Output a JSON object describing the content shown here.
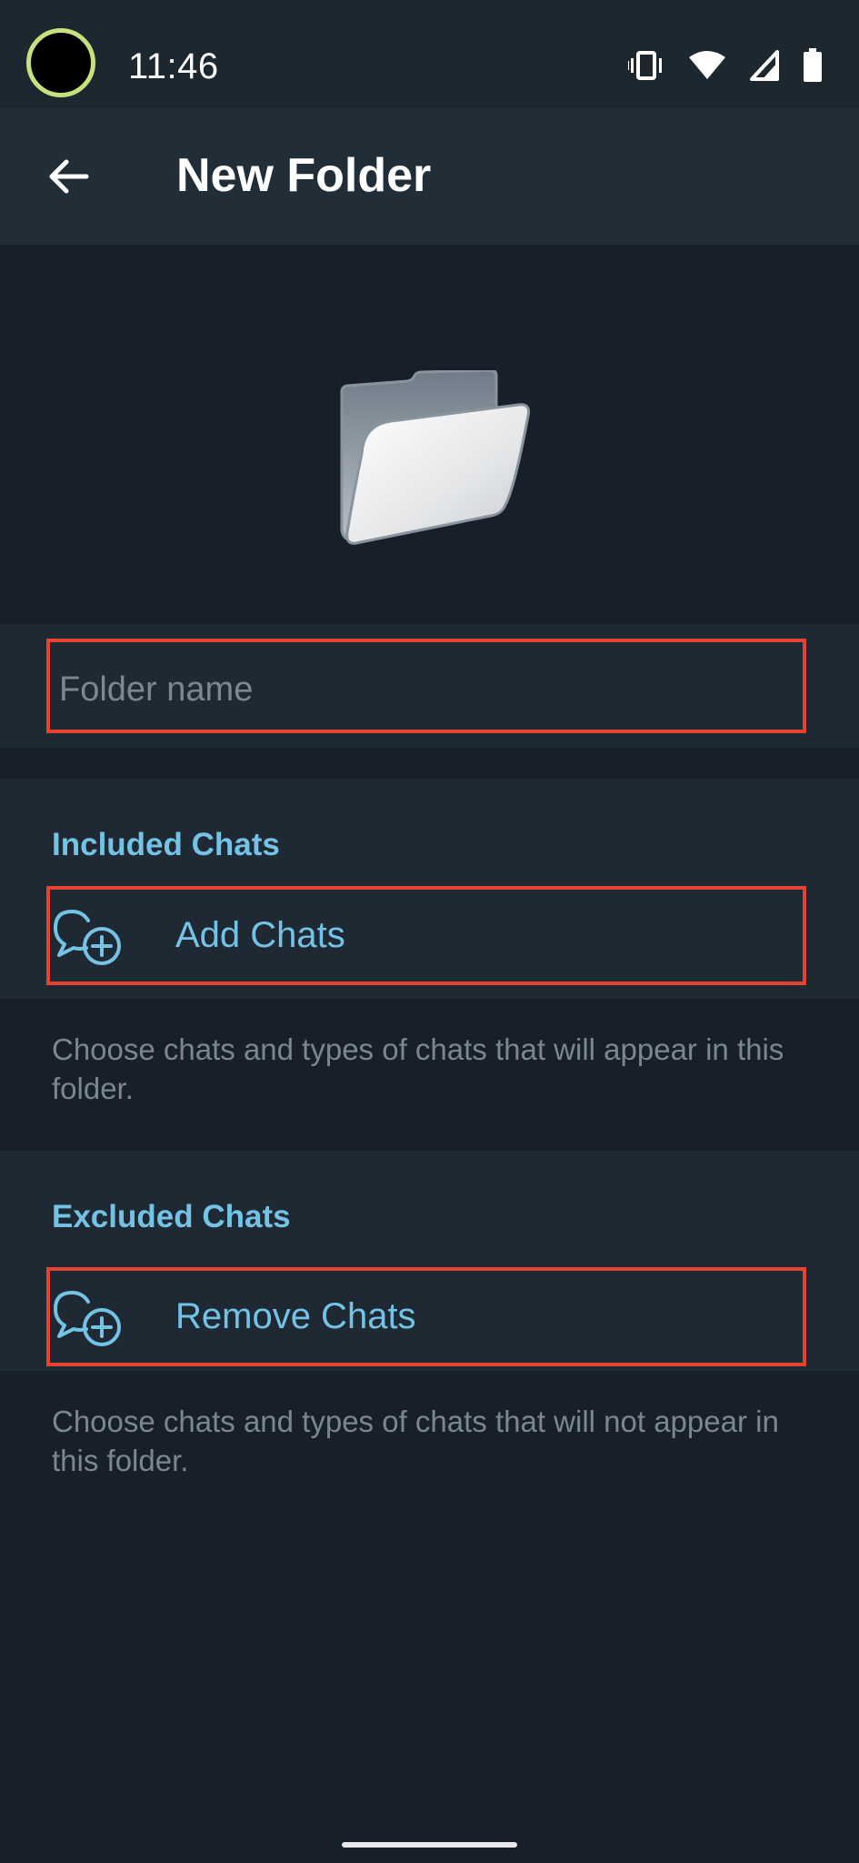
{
  "status_bar": {
    "time": "11:46",
    "icons": [
      "vibrate-icon",
      "wifi-icon",
      "signal-icon",
      "battery-icon"
    ]
  },
  "app_bar": {
    "back_icon": "arrow-left-icon",
    "title": "New Folder"
  },
  "folder_illustration": {
    "icon": "folder-icon"
  },
  "name_field": {
    "placeholder": "Folder name",
    "value": ""
  },
  "included": {
    "header": "Included Chats",
    "action_label": "Add Chats",
    "action_icon": "chat-add-icon",
    "hint": "Choose chats and types of chats that will appear in this folder."
  },
  "excluded": {
    "header": "Excluded Chats",
    "action_label": "Remove Chats",
    "action_icon": "chat-add-icon",
    "hint": "Choose chats and types of chats that will not appear in this folder."
  },
  "colors": {
    "accent": "#74c3e6",
    "highlight_border": "#e5432f",
    "background": "#17202a",
    "card": "#1f2933",
    "app_bar": "#212d37"
  }
}
